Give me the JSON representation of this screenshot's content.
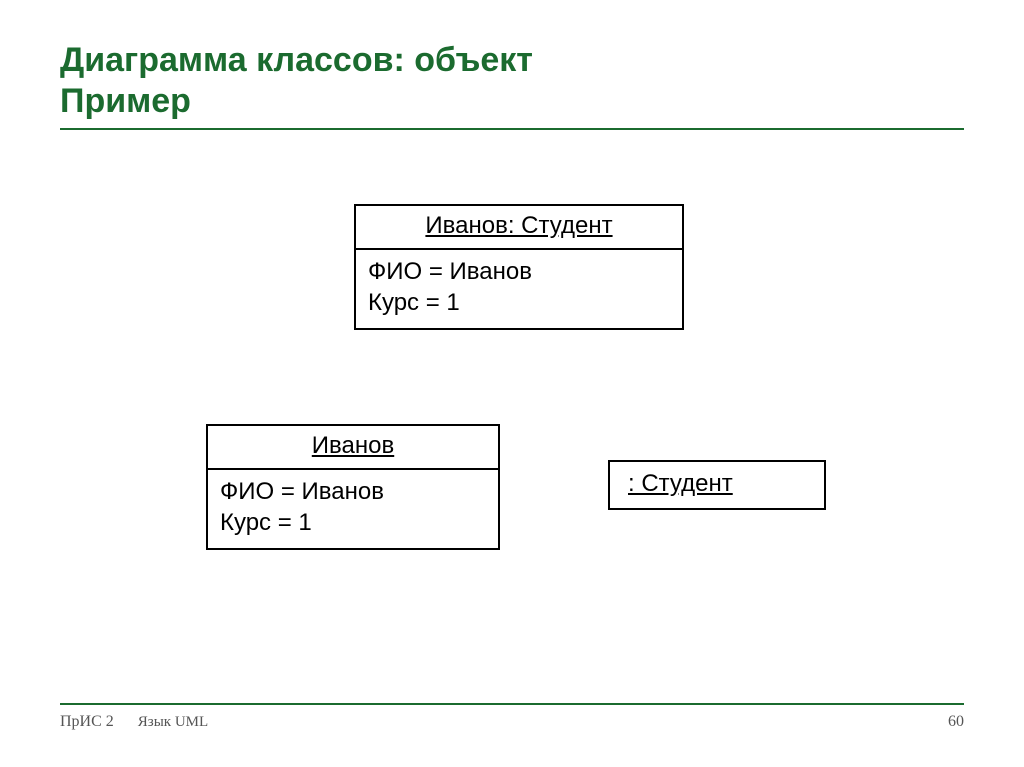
{
  "title": {
    "line1": "Диаграмма классов: объект",
    "line2": "Пример"
  },
  "boxes": {
    "top": {
      "header": "Иванов: Студент",
      "attr1": "ФИО = Иванов",
      "attr2": "Курс = 1"
    },
    "left": {
      "header": "Иванов",
      "attr1": "ФИО = Иванов",
      "attr2": "Курс = 1"
    },
    "right": {
      "label": ": Студент"
    }
  },
  "footer": {
    "left1": "ПрИС 2",
    "left2": "Язык UML",
    "page": "60"
  }
}
